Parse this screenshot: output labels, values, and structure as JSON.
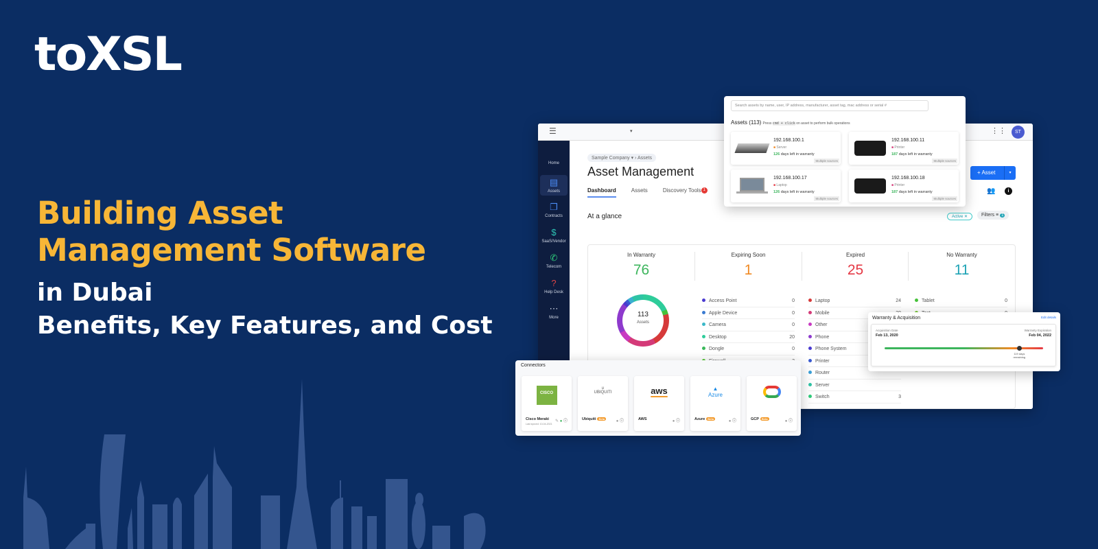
{
  "brand": {
    "logo": "toXSL"
  },
  "headline": {
    "line1": "Building Asset",
    "line2": "Management Software",
    "line3": "in Dubai",
    "line4": "Benefits, Key Features, and Cost"
  },
  "colors": {
    "background": "#0b2d63",
    "accent": "#f7b637",
    "primary": "#1a6ef5"
  },
  "app": {
    "avatar": "ST",
    "sidebar": [
      {
        "label": "Home",
        "icon": "home-icon"
      },
      {
        "label": "Assets",
        "icon": "box-icon"
      },
      {
        "label": "Contracts",
        "icon": "documents-icon"
      },
      {
        "label": "SaaS/Vendor",
        "icon": "receipt-icon"
      },
      {
        "label": "Telecom",
        "icon": "phone-icon"
      },
      {
        "label": "Help Desk",
        "icon": "question-icon"
      },
      {
        "label": "More",
        "icon": "more-icon"
      }
    ],
    "breadcrumb": {
      "company": "Sample Company",
      "page": "Assets"
    },
    "title": "Asset Management",
    "tabs": [
      {
        "label": "Dashboard"
      },
      {
        "label": "Assets"
      },
      {
        "label": "Discovery Tools",
        "badge": "1"
      }
    ],
    "add_button": "+ Asset",
    "section": "At a glance",
    "filter_chip": "Active",
    "filters_label": "Filters",
    "filters_count": "1",
    "stats": [
      {
        "label": "In Warranty",
        "value": "76",
        "color": "#3cb55c"
      },
      {
        "label": "Expiring Soon",
        "value": "1",
        "color": "#f08a24"
      },
      {
        "label": "Expired",
        "value": "25",
        "color": "#e53945"
      },
      {
        "label": "No Warranty",
        "value": "11",
        "color": "#1ea3b5"
      }
    ],
    "donut": {
      "total": "113",
      "label": "Assets"
    },
    "legend": [
      [
        {
          "n": "Access Point",
          "v": "0",
          "c": "#4a3ad0"
        },
        {
          "n": "Apple Device",
          "v": "0",
          "c": "#3a7ad0"
        },
        {
          "n": "Camera",
          "v": "0",
          "c": "#3ab8c8"
        },
        {
          "n": "Desktop",
          "v": "20",
          "c": "#2ecc9a"
        },
        {
          "n": "Dongle",
          "v": "0",
          "c": "#3ab85a"
        },
        {
          "n": "Firewall",
          "v": "3",
          "c": "#5ac83a"
        },
        {
          "n": "Gateway",
          "v": "0",
          "c": "#9ac83a"
        }
      ],
      [
        {
          "n": "Laptop",
          "v": "24",
          "c": "#d63a3a"
        },
        {
          "n": "Mobile",
          "v": "20",
          "c": "#d43a78"
        },
        {
          "n": "Other",
          "v": "8",
          "c": "#c83ac2"
        },
        {
          "n": "Phone",
          "v": "",
          "c": "#8e3acd"
        },
        {
          "n": "Phone System",
          "v": "",
          "c": "#4a3ad0"
        },
        {
          "n": "Printer",
          "v": "",
          "c": "#3a5ad0"
        },
        {
          "n": "Router",
          "v": "",
          "c": "#3aa0d8"
        },
        {
          "n": "Server",
          "v": "",
          "c": "#2ec4a5"
        },
        {
          "n": "Switch",
          "v": "3",
          "c": "#2ecc7a"
        }
      ],
      [
        {
          "n": "Tablet",
          "v": "0",
          "c": "#46c23a"
        },
        {
          "n": "Test",
          "v": "0",
          "c": "#7ac83a"
        },
        {
          "n": "Thin Client",
          "v": "0",
          "c": "#b8c83a"
        }
      ]
    ]
  },
  "search": {
    "placeholder": "Search assets by name, user, IP address, manufacturer, asset tag, mac address or serial #",
    "count_label": "Assets (113)",
    "hint_pre": "Press",
    "hint_key": "cmd + click",
    "hint_post": "on asset to perform bulk operations",
    "assets": [
      {
        "ip": "192.168.100.1",
        "type": "Server",
        "days": "126",
        "suffix": "days left in warranty",
        "source": "Multiple sources"
      },
      {
        "ip": "192.168.100.11",
        "type": "Printer",
        "days": "187",
        "suffix": "days left in warranty",
        "source": "Multiple sources"
      },
      {
        "ip": "192.168.100.17",
        "type": "Laptop",
        "days": "126",
        "suffix": "days left in warranty",
        "source": "Multiple sources"
      },
      {
        "ip": "192.168.100.18",
        "type": "Printer",
        "days": "187",
        "suffix": "days left in warranty",
        "source": "Multiple sources"
      }
    ]
  },
  "warranty": {
    "title": "Warranty & Acquisition",
    "edit": "Edit details",
    "acq_label": "Acquisition Date",
    "acq_date": "Feb 13, 2020",
    "exp_label": "Warranty Expiration",
    "exp_date": "Feb 04, 2022",
    "remaining": "119 days remaining",
    "progress": 0.85
  },
  "connectors": {
    "title": "Connectors",
    "items": [
      {
        "name": "Cisco Meraki",
        "sub": "Last synced: 10-04-2021",
        "beta": ""
      },
      {
        "name": "Ubiquiti",
        "beta": "Beta"
      },
      {
        "name": "AWS",
        "beta": ""
      },
      {
        "name": "Azure",
        "beta": "Beta"
      },
      {
        "name": "GCP",
        "beta": "Beta"
      }
    ]
  }
}
